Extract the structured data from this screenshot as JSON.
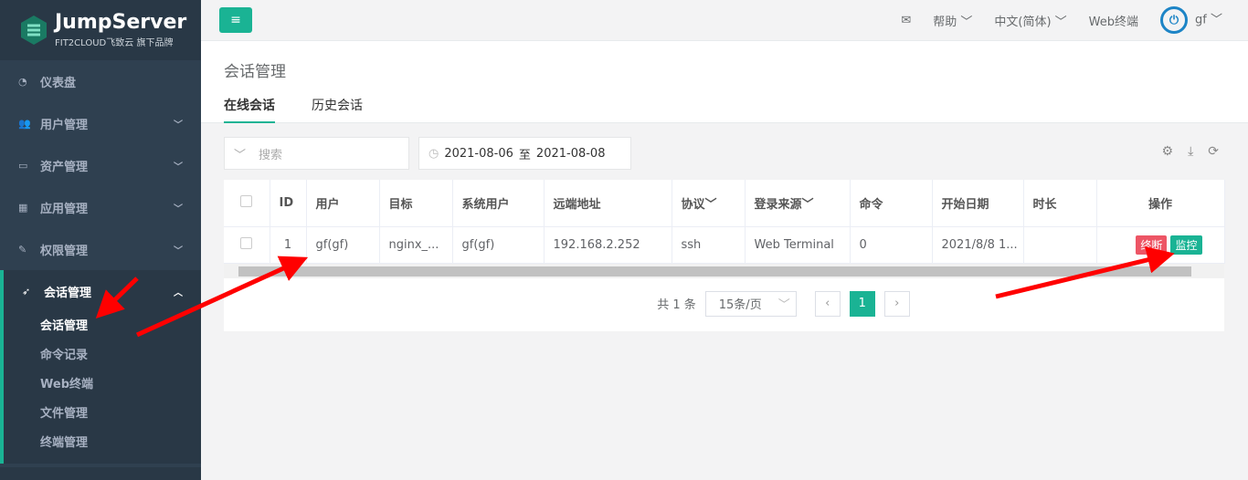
{
  "brand": {
    "name": "JumpServer",
    "tagline": "FIT2CLOUD飞致云 旗下品牌"
  },
  "sidebar": {
    "items": [
      {
        "label": "仪表盘",
        "icon": "dashboard-icon"
      },
      {
        "label": "用户管理",
        "icon": "users-icon"
      },
      {
        "label": "资产管理",
        "icon": "inbox-icon"
      },
      {
        "label": "应用管理",
        "icon": "grid-icon"
      },
      {
        "label": "权限管理",
        "icon": "edit-icon"
      },
      {
        "label": "会话管理",
        "icon": "rocket-icon"
      }
    ],
    "sub_items": [
      "会话管理",
      "命令记录",
      "Web终端",
      "文件管理",
      "终端管理"
    ]
  },
  "topbar": {
    "help": "帮助",
    "language": "中文(简体)",
    "web_terminal": "Web终端",
    "user": "gf"
  },
  "page": {
    "title": "会话管理",
    "tabs": [
      "在线会话",
      "历史会话"
    ]
  },
  "filters": {
    "search_placeholder": "搜索",
    "date_from": "2021-08-06",
    "date_sep": "至",
    "date_to": "2021-08-08"
  },
  "table": {
    "headers": [
      "ID",
      "用户",
      "目标",
      "系统用户",
      "远端地址",
      "协议",
      "登录来源",
      "命令",
      "开始日期",
      "时长",
      "操作"
    ],
    "rows": [
      {
        "id": "1",
        "user": "gf(gf)",
        "target": "nginx_...",
        "system_user": "gf(gf)",
        "remote": "192.168.2.252",
        "protocol": "ssh",
        "source": "Web Terminal",
        "commands": "0",
        "start": "2021/8/8 1...",
        "duration": "",
        "actions": [
          "终断",
          "监控"
        ]
      }
    ]
  },
  "pagination": {
    "total": "共 1 条",
    "page_size": "15条/页",
    "current": "1"
  },
  "colors": {
    "accent": "#1ab394",
    "danger": "#ed5565",
    "sidebar": "#2f4050",
    "annotation": "#ff0000"
  }
}
